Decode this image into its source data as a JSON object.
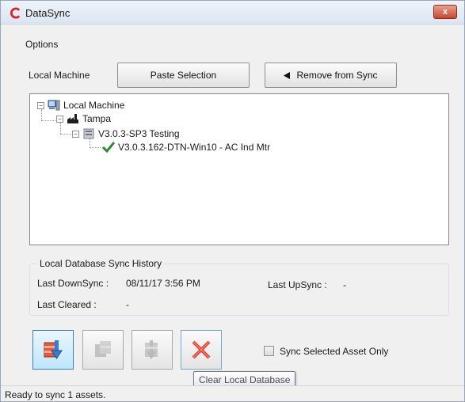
{
  "window": {
    "title": "DataSync",
    "close_label": "x"
  },
  "menu": {
    "options_label": "Options"
  },
  "toolbar": {
    "section_label": "Local Machine",
    "paste_label": "Paste Selection",
    "remove_label": "Remove from Sync"
  },
  "tree": {
    "root": "Local Machine",
    "site": "Tampa",
    "version": "V3.0.3-SP3 Testing",
    "asset": "V3.0.3.162-DTN-Win10 - AC Ind Mtr"
  },
  "history": {
    "title": "Local Database Sync History",
    "downsync_label": "Last DownSync :",
    "downsync_value": "08/11/17 3:56 PM",
    "upsync_label": "Last UpSync :",
    "upsync_value": "-",
    "cleared_label": "Last Cleared :",
    "cleared_value": "-"
  },
  "options": {
    "sync_selected_label": "Sync Selected Asset Only",
    "sync_selected_checked": false
  },
  "tooltip": {
    "text": "Clear Local Database"
  },
  "status": {
    "text": "Ready to sync 1 assets."
  },
  "colors": {
    "accent_blue": "#3c7fb1",
    "check_green": "#2e8b2e",
    "clear_red": "#e03a2a",
    "close_red": "#c9462c"
  }
}
